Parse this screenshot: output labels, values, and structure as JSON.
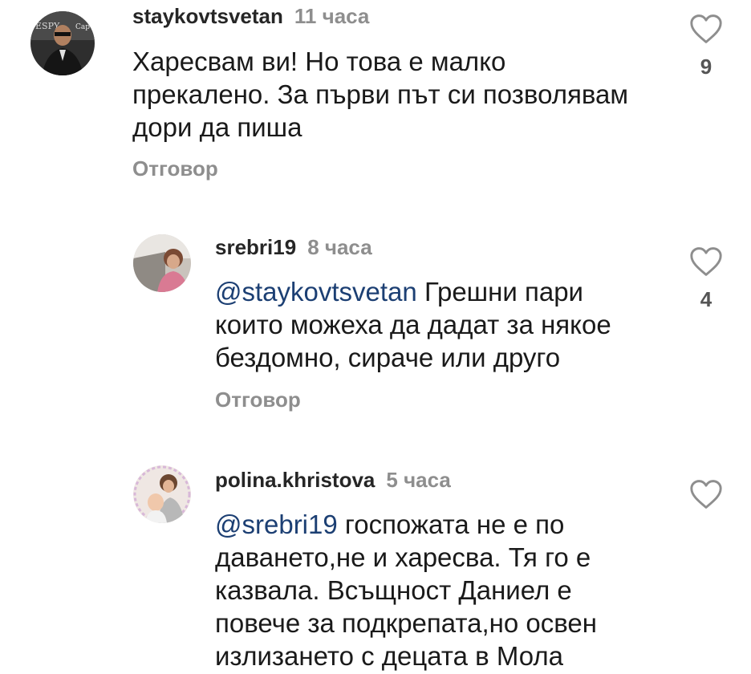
{
  "comments": [
    {
      "username": "staykovtsvetan",
      "time": "11 часа",
      "mention": "",
      "text": "Харесвам ви! Но това е малко\nпрекалено. За първи път си позволявам\nдори да пиша",
      "reply_label": "Отговор",
      "likes": "9"
    },
    {
      "username": "srebri19",
      "time": "8 часа",
      "mention": "@staykovtsvetan",
      "text": " Грешни пари\nкоито можеха да дадат за някое\nбездомно, сираче или друго",
      "reply_label": "Отговор",
      "likes": "4"
    },
    {
      "username": "polina.khristova",
      "time": "5 часа",
      "mention": "@srebri19",
      "text": " госпожата не е по\nдаването,не и харесва. Тя го е\nказвала. Всъщност Даниел е\nповече за подкрепата,но освен\nизлизането с децата в Мола",
      "reply_label": "",
      "likes": ""
    }
  ],
  "colors": {
    "username": "#262626",
    "time": "#8e8e8e",
    "mention": "#1c3f73",
    "heart_outline": "#8e8e8e"
  }
}
